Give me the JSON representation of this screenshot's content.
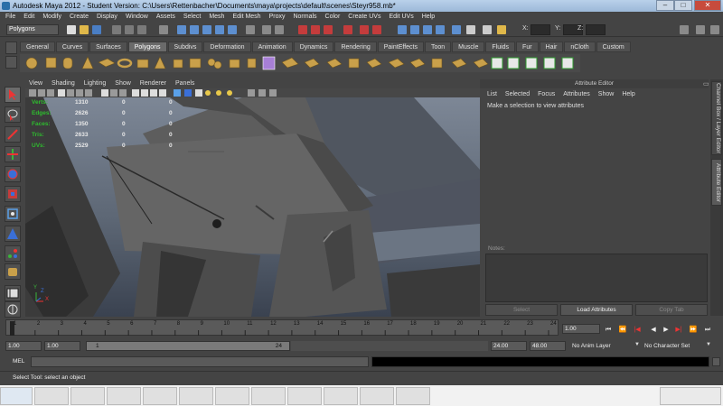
{
  "window": {
    "title": "Autodesk Maya 2012 - Student Version: C:\\Users\\Rettenbacher\\Documents\\maya\\projects\\default\\scenes\\Steyr958.mb*",
    "minimize": "–",
    "maximize": "□",
    "close": "✕"
  },
  "menubar": [
    "File",
    "Edit",
    "Modify",
    "Create",
    "Display",
    "Window",
    "Assets",
    "Select",
    "Mesh",
    "Edit Mesh",
    "Proxy",
    "Normals",
    "Color",
    "Create UVs",
    "Edit UVs",
    "Help"
  ],
  "statusline": {
    "mode": "Polygons",
    "x_label": "X:",
    "y_label": "Y:",
    "z_label": "Z:"
  },
  "shelf": {
    "tabs": [
      "General",
      "Curves",
      "Surfaces",
      "Polygons",
      "Subdivs",
      "Deformation",
      "Animation",
      "Dynamics",
      "Rendering",
      "PaintEffects",
      "Toon",
      "Muscle",
      "Fluids",
      "Fur",
      "Hair",
      "nCloth",
      "Custom"
    ],
    "active_tab": "Polygons"
  },
  "viewport": {
    "menu": [
      "View",
      "Shading",
      "Lighting",
      "Show",
      "Renderer",
      "Panels"
    ],
    "hud": [
      {
        "label": "Verts:",
        "v1": "1310",
        "v2": "0",
        "v3": "0"
      },
      {
        "label": "Edges:",
        "v1": "2626",
        "v2": "0",
        "v3": "0"
      },
      {
        "label": "Faces:",
        "v1": "1350",
        "v2": "0",
        "v3": "0"
      },
      {
        "label": "Tris:",
        "v1": "2633",
        "v2": "0",
        "v3": "0"
      },
      {
        "label": "UVs:",
        "v1": "2529",
        "v2": "0",
        "v3": "0"
      }
    ],
    "axis_x": "X",
    "axis_y": "Y",
    "axis_z": "Z"
  },
  "attribute_editor": {
    "title": "Attribute Editor",
    "menu": [
      "List",
      "Selected",
      "Focus",
      "Attributes",
      "Show",
      "Help"
    ],
    "message": "Make a selection to view attributes",
    "notes_label": "Notes:",
    "buttons": {
      "select": "Select",
      "load": "Load Attributes",
      "copy": "Copy Tab"
    }
  },
  "side_tabs": {
    "channel_box": "Channel Box / Layer Editor",
    "attribute_editor": "Attribute Editor"
  },
  "timeline": {
    "ticks": [
      "1",
      "2",
      "3",
      "4",
      "5",
      "6",
      "7",
      "8",
      "9",
      "10",
      "11",
      "12",
      "13",
      "14",
      "15",
      "16",
      "17",
      "18",
      "19",
      "20",
      "21",
      "22",
      "23",
      "24"
    ],
    "current_frame": "1.00"
  },
  "range": {
    "start_time": "1.00",
    "playback_start": "1.00",
    "slider_start": "1",
    "slider_end": "24",
    "playback_end": "24.00",
    "end_time": "48.00",
    "anim_layer": "No Anim Layer",
    "character_set": "No Character Set"
  },
  "command_line": {
    "label": "MEL"
  },
  "help_line": "Select Tool: select an object",
  "colors": {
    "accent": "#2ebd2e",
    "panel": "#444444",
    "viewport_top": "#7d8796",
    "viewport_bottom": "#3a4250"
  }
}
